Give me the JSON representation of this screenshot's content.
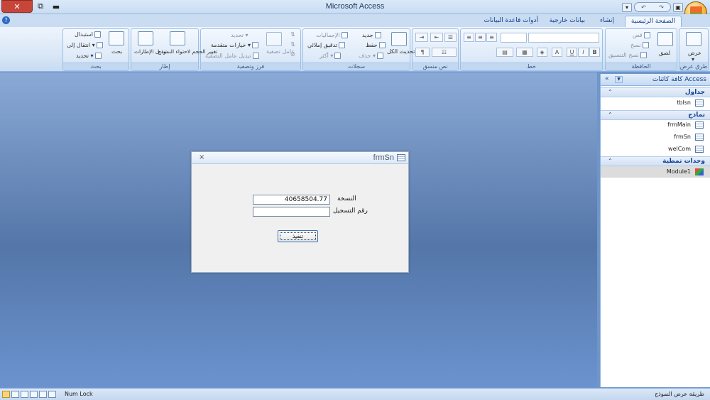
{
  "window": {
    "title": "Microsoft Access"
  },
  "tabs": [
    "الصفحة الرئيسية",
    "إنشاء",
    "بيانات خارجية",
    "أدوات قاعدة البيانات"
  ],
  "ribbon": {
    "views": {
      "label": "طرق عرض",
      "view": "عرض"
    },
    "clipboard": {
      "label": "الحافظة",
      "paste": "لصق",
      "cut": "قص",
      "copy": "نسخ",
      "format_painter": "نسخ التنسيق"
    },
    "font": {
      "label": "خط",
      "bold": "B",
      "italic": "I",
      "underline": "U",
      "font_color": "A"
    },
    "rich_text": {
      "label": "نص منسق"
    },
    "records": {
      "label": "سجلات",
      "refresh_all": "تحديث الكل",
      "new": "جديد",
      "save": "حفظ",
      "delete": "حذف",
      "totals": "الإجماليات",
      "spelling": "تدقيق إملائي",
      "more": "أكثر"
    },
    "sort_filter": {
      "label": "فرز وتصفية",
      "filter": "عامل تصفية",
      "selection": "تحديد",
      "advanced": "خيارات متقدمة",
      "toggle_filter": "تبديل عامل التصفية"
    },
    "window": {
      "label": "إطار",
      "size_to_fit": "تغيير الحجم لاحتواء النموذج",
      "switch_windows": "تبديل الإطارات"
    },
    "find": {
      "label": "بحث",
      "find": "بحث",
      "replace": "استبدال",
      "goto": "انتقال إلى",
      "select": "تحديد"
    }
  },
  "nav_pane": {
    "title": "كافة كائنات Access",
    "groups": [
      {
        "name": "جداول",
        "items": [
          "tblsn"
        ]
      },
      {
        "name": "نماذج",
        "items": [
          "frmMain",
          "frmSn",
          "welCom"
        ]
      },
      {
        "name": "وحدات نمطية",
        "items": [
          "Module1"
        ]
      }
    ]
  },
  "form": {
    "title": "frmSn",
    "copy_label": "النسخة",
    "copy_value": "40658504.77",
    "reg_label": "رقم التسجيل",
    "reg_value": "",
    "run_button": "تنفيذ"
  },
  "status": {
    "num_lock": "Num Lock",
    "view_mode": "طريقة عرض النموذج"
  }
}
